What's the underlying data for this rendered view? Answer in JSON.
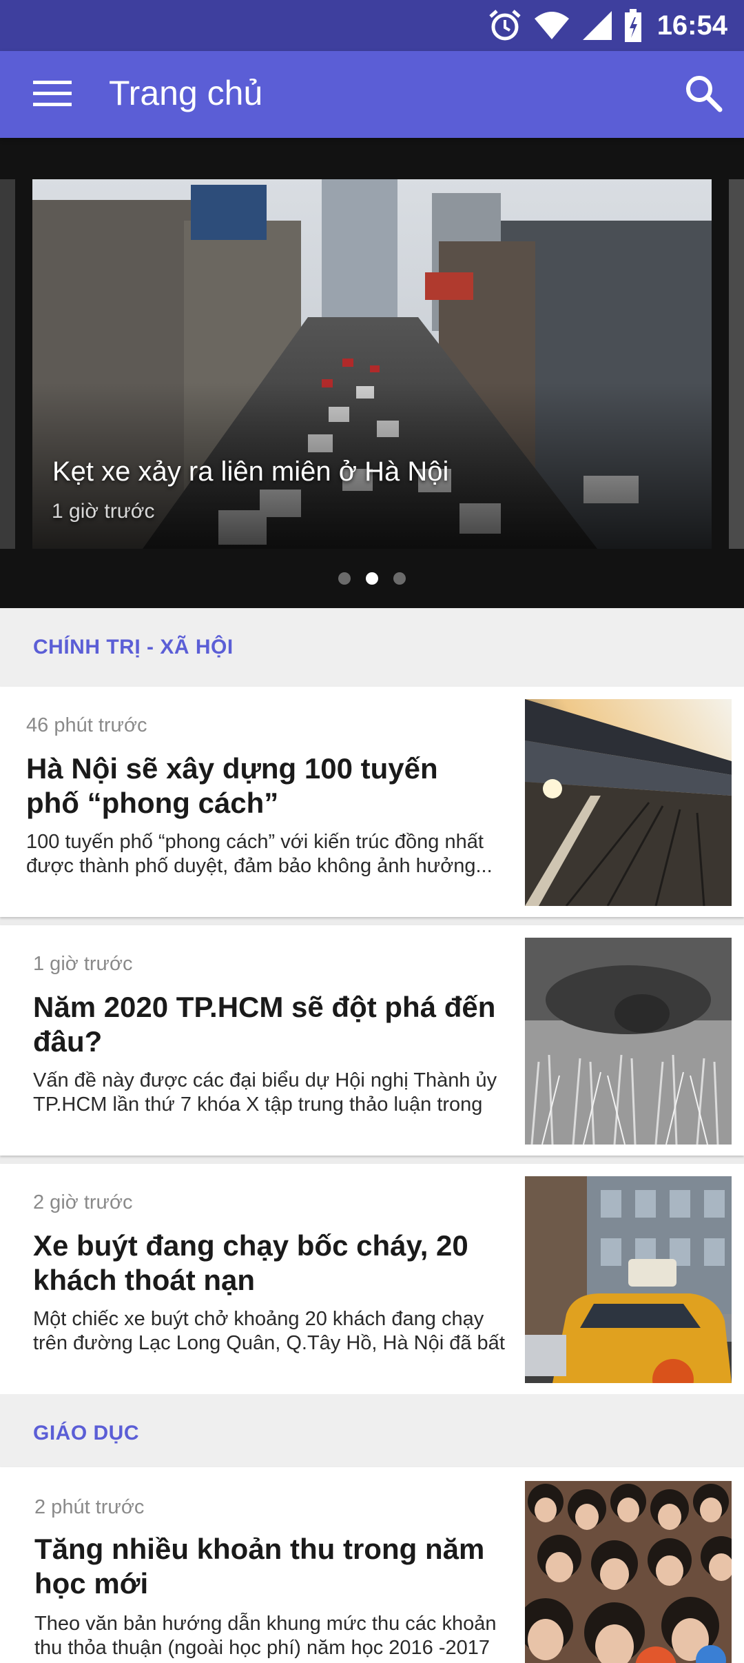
{
  "status_bar": {
    "time": "16:54",
    "icons": [
      "alarm-icon",
      "wifi-icon",
      "signal-icon",
      "battery-icon"
    ]
  },
  "app_bar": {
    "title": "Trang chủ",
    "icons": [
      "menu-icon",
      "search-icon"
    ]
  },
  "carousel": {
    "slide_title": "Kẹt xe xảy ra liên miên ở Hà Nội",
    "slide_time": "1 giờ trước",
    "page_count": 3,
    "active_page": 2
  },
  "sections": [
    {
      "title": "CHÍNH TRỊ - XÃ HỘI",
      "articles": [
        {
          "time": "46 phút trước",
          "headline": "Hà Nội sẽ xây dựng 100 tuyến phố “phong cách”",
          "summary": "100 tuyến phố “phong cách” với kiến trúc đồng nhất được thành phố duyệt, đảm bảo không ảnh hưởng..."
        },
        {
          "time": "1 giờ trước",
          "headline": "Năm 2020 TP.HCM sẽ đột phá đến đâu?",
          "summary": "Vấn đề này được các đại biểu dự Hội nghị Thành ủy TP.HCM lần thứ 7 khóa X tập trung thảo luận trong"
        },
        {
          "time": "2 giờ trước",
          "headline": "Xe buýt đang chạy bốc cháy, 20 khách thoát nạn",
          "summary": "Một chiếc xe buýt chở khoảng 20 khách đang chạy trên đường Lạc Long Quân, Q.Tây Hồ, Hà Nội đã bất"
        }
      ]
    },
    {
      "title": "GIÁO DỤC",
      "articles": [
        {
          "time": "2 phút trước",
          "headline": "Tăng nhiều khoản thu trong năm học mới",
          "summary": "Theo văn bản hướng dẫn khung mức thu các khoản thu thỏa thuận (ngoài học phí) năm học 2016 -2017"
        }
      ]
    }
  ],
  "colors": {
    "accent": "#5b5ed6",
    "status_bar": "#3e3f9e",
    "carousel_bg": "#121212"
  }
}
